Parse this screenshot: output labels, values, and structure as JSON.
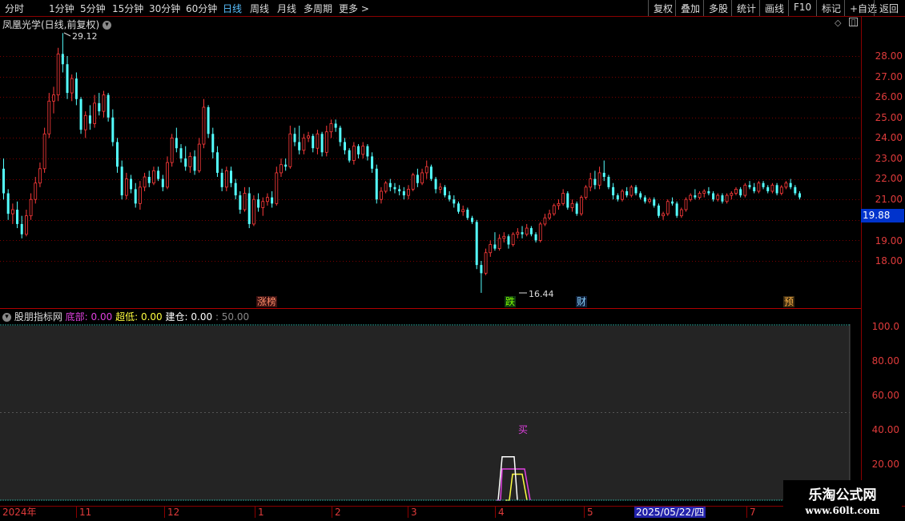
{
  "toolbar": {
    "periods": [
      "分时",
      "1分钟",
      "5分钟",
      "15分钟",
      "30分钟",
      "60分钟",
      "日线",
      "周线",
      "月线",
      "多周期",
      "更多 >"
    ],
    "active_period": "日线",
    "actions": [
      "复权",
      "叠加",
      "多股",
      "统计",
      "画线",
      "F10",
      "标记",
      "+自选",
      "返回"
    ]
  },
  "main": {
    "title": "凤凰光学(日线,前复权)",
    "price_axis": [
      "28.00",
      "27.00",
      "26.00",
      "25.00",
      "24.00",
      "23.00",
      "22.00",
      "21.00",
      "19.00",
      "18.00"
    ],
    "current_price": "19.88",
    "high_marker": "29.12",
    "low_marker": "16.44",
    "events": [
      {
        "label": "涨榜",
        "color": "#ff8c69"
      },
      {
        "label": "跌",
        "color": "#7CFC00"
      },
      {
        "label": "财",
        "color": "#87cefa"
      },
      {
        "label": "预",
        "color": "#ffb347"
      }
    ]
  },
  "indicator": {
    "name": "股朋指标网",
    "items": [
      {
        "label": "底部:",
        "value": "0.00",
        "color": "#e040e0"
      },
      {
        "label": "超低:",
        "value": "0.00",
        "color": "#ffff40"
      },
      {
        "label": "建仓:",
        "value": "0.00",
        "color": "#ffffff"
      }
    ],
    "extra": ": 50.00",
    "axis": [
      "100.0",
      "80.00",
      "60.00",
      "40.00",
      "20.00"
    ],
    "signal_text": "买"
  },
  "dates": [
    "2024年",
    "11",
    "12",
    "1",
    "2",
    "3",
    "4",
    "5",
    "2025/05/22/四",
    "7"
  ],
  "watermark": {
    "line1": "乐淘公式网",
    "line2": "www.60lt.com"
  },
  "colors": {
    "up": "#ff3b3b",
    "down": "#54ffff",
    "grid": "#8b0000",
    "accent": "#59c0ff"
  },
  "chart_data": {
    "type": "candlestick",
    "series": [
      {
        "values": [
          [
            22.5,
            23.0,
            21.0,
            21.3
          ],
          [
            21.3,
            21.5,
            20.0,
            20.3
          ],
          [
            20.3,
            20.8,
            19.8,
            20.5
          ],
          [
            20.5,
            20.9,
            19.6,
            19.8
          ],
          [
            19.8,
            20.2,
            19.1,
            19.3
          ],
          [
            19.3,
            20.5,
            19.2,
            20.2
          ],
          [
            20.2,
            21.3,
            20.0,
            21.0
          ],
          [
            21.0,
            22.1,
            20.8,
            21.8
          ],
          [
            21.8,
            22.8,
            21.6,
            22.5
          ],
          [
            22.5,
            24.5,
            22.3,
            24.2
          ],
          [
            24.2,
            26.2,
            24.0,
            25.8
          ],
          [
            25.8,
            26.5,
            25.2,
            26.1
          ],
          [
            26.1,
            28.4,
            25.8,
            28.1
          ],
          [
            28.1,
            29.12,
            27.2,
            27.6
          ],
          [
            27.6,
            28.0,
            25.9,
            26.2
          ],
          [
            26.2,
            27.1,
            25.8,
            26.9
          ],
          [
            26.9,
            27.2,
            25.6,
            25.9
          ],
          [
            25.9,
            26.0,
            24.2,
            24.4
          ],
          [
            24.4,
            25.3,
            24.0,
            25.1
          ],
          [
            25.1,
            25.6,
            24.4,
            24.7
          ],
          [
            24.7,
            26.1,
            24.5,
            25.7
          ],
          [
            25.7,
            26.2,
            25.1,
            25.3
          ],
          [
            25.3,
            26.3,
            25.0,
            26.1
          ],
          [
            26.1,
            26.2,
            24.8,
            25.0
          ],
          [
            25.0,
            25.4,
            23.6,
            23.8
          ],
          [
            23.8,
            24.0,
            22.3,
            22.6
          ],
          [
            22.6,
            22.9,
            21.0,
            21.2
          ],
          [
            21.2,
            22.3,
            21.0,
            22.0
          ],
          [
            22.0,
            22.2,
            21.3,
            21.5
          ],
          [
            21.5,
            21.8,
            20.6,
            20.8
          ],
          [
            20.8,
            21.9,
            20.5,
            21.6
          ],
          [
            21.6,
            22.3,
            21.4,
            22.1
          ],
          [
            22.1,
            22.4,
            21.6,
            21.8
          ],
          [
            21.8,
            22.6,
            21.7,
            22.4
          ],
          [
            22.4,
            22.6,
            21.9,
            22.0
          ],
          [
            22.0,
            22.2,
            21.4,
            21.6
          ],
          [
            21.6,
            23.1,
            21.5,
            22.8
          ],
          [
            22.8,
            24.2,
            22.6,
            24.0
          ],
          [
            24.0,
            24.5,
            23.3,
            23.5
          ],
          [
            23.5,
            23.7,
            22.8,
            23.0
          ],
          [
            23.0,
            23.6,
            22.4,
            22.6
          ],
          [
            22.6,
            23.3,
            22.3,
            23.1
          ],
          [
            23.1,
            23.4,
            22.2,
            22.4
          ],
          [
            22.4,
            24.0,
            22.3,
            23.7
          ],
          [
            23.7,
            25.9,
            23.5,
            25.5
          ],
          [
            25.5,
            25.6,
            24.0,
            24.2
          ],
          [
            24.2,
            24.5,
            23.0,
            23.3
          ],
          [
            23.3,
            23.6,
            22.1,
            22.3
          ],
          [
            22.3,
            22.5,
            21.4,
            21.6
          ],
          [
            21.6,
            22.6,
            21.4,
            22.4
          ],
          [
            22.4,
            22.6,
            21.6,
            21.8
          ],
          [
            21.8,
            22.0,
            21.0,
            21.2
          ],
          [
            21.2,
            21.4,
            20.3,
            20.5
          ],
          [
            20.5,
            21.6,
            20.4,
            21.3
          ],
          [
            21.3,
            21.6,
            19.6,
            19.8
          ],
          [
            19.8,
            21.2,
            19.7,
            21.0
          ],
          [
            21.0,
            21.3,
            20.4,
            20.6
          ],
          [
            20.6,
            21.1,
            20.2,
            20.9
          ],
          [
            20.9,
            21.3,
            20.7,
            21.1
          ],
          [
            21.1,
            21.4,
            20.6,
            20.8
          ],
          [
            20.8,
            22.6,
            20.7,
            22.3
          ],
          [
            22.3,
            23.0,
            22.1,
            22.7
          ],
          [
            22.7,
            23.0,
            22.4,
            22.6
          ],
          [
            22.6,
            24.6,
            22.5,
            24.2
          ],
          [
            24.2,
            24.5,
            23.6,
            23.8
          ],
          [
            23.8,
            24.6,
            23.2,
            23.4
          ],
          [
            23.4,
            24.2,
            23.2,
            24.0
          ],
          [
            24.0,
            24.3,
            23.8,
            24.1
          ],
          [
            24.1,
            24.2,
            23.3,
            23.5
          ],
          [
            23.5,
            24.4,
            23.2,
            24.2
          ],
          [
            24.2,
            24.3,
            23.1,
            23.3
          ],
          [
            23.3,
            24.6,
            23.1,
            24.3
          ],
          [
            24.3,
            24.9,
            24.0,
            24.7
          ],
          [
            24.7,
            24.9,
            24.3,
            24.5
          ],
          [
            24.5,
            24.6,
            23.6,
            23.8
          ],
          [
            23.8,
            24.0,
            23.2,
            23.4
          ],
          [
            23.4,
            23.5,
            22.8,
            22.9
          ],
          [
            22.9,
            23.8,
            22.7,
            23.6
          ],
          [
            23.6,
            23.7,
            23.0,
            23.2
          ],
          [
            23.2,
            23.8,
            23.0,
            23.6
          ],
          [
            23.6,
            23.7,
            22.9,
            23.1
          ],
          [
            23.1,
            23.3,
            22.3,
            22.5
          ],
          [
            22.5,
            22.7,
            20.8,
            21.0
          ],
          [
            21.0,
            21.6,
            20.8,
            21.4
          ],
          [
            21.4,
            21.9,
            21.3,
            21.8
          ],
          [
            21.8,
            22.0,
            21.4,
            21.6
          ],
          [
            21.6,
            21.8,
            21.3,
            21.5
          ],
          [
            21.5,
            21.7,
            21.2,
            21.4
          ],
          [
            21.4,
            21.6,
            21.0,
            21.2
          ],
          [
            21.2,
            21.7,
            21.0,
            21.5
          ],
          [
            21.5,
            22.3,
            21.4,
            22.2
          ],
          [
            22.2,
            22.5,
            21.6,
            21.8
          ],
          [
            21.8,
            22.5,
            21.7,
            22.3
          ],
          [
            22.3,
            22.9,
            22.0,
            22.6
          ],
          [
            22.6,
            22.7,
            21.9,
            22.0
          ],
          [
            22.0,
            22.1,
            21.3,
            21.5
          ],
          [
            21.5,
            21.8,
            21.3,
            21.6
          ],
          [
            21.6,
            21.7,
            21.1,
            21.2
          ],
          [
            21.2,
            21.4,
            20.9,
            21.0
          ],
          [
            21.0,
            21.2,
            20.6,
            20.8
          ],
          [
            20.8,
            20.9,
            20.3,
            20.4
          ],
          [
            20.4,
            20.7,
            20.2,
            20.5
          ],
          [
            20.5,
            20.6,
            20.0,
            20.1
          ],
          [
            20.1,
            20.2,
            19.8,
            19.9
          ],
          [
            19.9,
            20.0,
            17.6,
            17.8
          ],
          [
            17.8,
            18.0,
            16.44,
            17.4
          ],
          [
            17.4,
            18.6,
            17.3,
            18.4
          ],
          [
            18.4,
            19.0,
            18.2,
            18.8
          ],
          [
            18.8,
            19.4,
            18.5,
            18.6
          ],
          [
            18.6,
            19.3,
            18.5,
            19.1
          ],
          [
            19.1,
            19.4,
            18.9,
            19.2
          ],
          [
            19.2,
            19.3,
            18.6,
            18.8
          ],
          [
            18.8,
            19.4,
            18.7,
            19.3
          ],
          [
            19.3,
            19.6,
            19.1,
            19.4
          ],
          [
            19.4,
            19.7,
            19.1,
            19.3
          ],
          [
            19.3,
            19.8,
            19.2,
            19.6
          ],
          [
            19.6,
            19.7,
            19.2,
            19.3
          ],
          [
            19.3,
            19.4,
            18.9,
            19.0
          ],
          [
            19.0,
            19.9,
            18.9,
            19.8
          ],
          [
            19.8,
            20.3,
            19.7,
            20.1
          ],
          [
            20.1,
            20.5,
            20.0,
            20.3
          ],
          [
            20.3,
            20.8,
            20.2,
            20.7
          ],
          [
            20.7,
            21.0,
            20.5,
            20.8
          ],
          [
            20.8,
            21.5,
            20.7,
            21.3
          ],
          [
            21.3,
            21.4,
            20.5,
            20.6
          ],
          [
            20.6,
            21.0,
            20.4,
            20.8
          ],
          [
            20.8,
            20.9,
            20.2,
            20.3
          ],
          [
            20.3,
            21.2,
            20.2,
            21.1
          ],
          [
            21.1,
            21.7,
            21.0,
            21.6
          ],
          [
            21.6,
            22.3,
            21.4,
            22.0
          ],
          [
            22.0,
            22.4,
            21.5,
            21.7
          ],
          [
            21.7,
            22.6,
            21.5,
            22.3
          ],
          [
            22.3,
            22.9,
            21.9,
            22.1
          ],
          [
            22.1,
            22.2,
            21.5,
            21.6
          ],
          [
            21.6,
            21.8,
            21.0,
            21.2
          ],
          [
            21.2,
            21.3,
            20.9,
            21.0
          ],
          [
            21.0,
            21.5,
            20.9,
            21.4
          ],
          [
            21.4,
            21.6,
            21.1,
            21.2
          ],
          [
            21.2,
            21.7,
            21.1,
            21.6
          ],
          [
            21.6,
            21.7,
            21.2,
            21.3
          ],
          [
            21.3,
            21.4,
            21.0,
            21.1
          ],
          [
            21.1,
            21.2,
            20.8,
            20.9
          ],
          [
            20.9,
            21.1,
            20.8,
            21.0
          ],
          [
            21.0,
            21.1,
            20.6,
            20.7
          ],
          [
            20.7,
            20.8,
            20.1,
            20.2
          ],
          [
            20.2,
            20.4,
            20.0,
            20.3
          ],
          [
            20.3,
            21.0,
            20.2,
            20.9
          ],
          [
            20.9,
            21.1,
            20.7,
            20.8
          ],
          [
            20.8,
            20.9,
            20.1,
            20.2
          ],
          [
            20.2,
            20.6,
            20.1,
            20.5
          ],
          [
            20.5,
            21.1,
            20.4,
            21.0
          ],
          [
            21.0,
            21.3,
            20.9,
            21.2
          ],
          [
            21.2,
            21.5,
            21.0,
            21.1
          ],
          [
            21.1,
            21.4,
            21.0,
            21.3
          ],
          [
            21.3,
            21.5,
            21.1,
            21.4
          ],
          [
            21.4,
            21.6,
            21.2,
            21.3
          ],
          [
            21.3,
            21.4,
            20.9,
            21.0
          ],
          [
            21.0,
            21.3,
            20.9,
            21.2
          ],
          [
            21.2,
            21.3,
            20.8,
            20.9
          ],
          [
            20.9,
            21.3,
            20.8,
            21.2
          ],
          [
            21.2,
            21.4,
            21.0,
            21.3
          ],
          [
            21.3,
            21.6,
            21.2,
            21.5
          ],
          [
            21.5,
            21.6,
            21.1,
            21.2
          ],
          [
            21.2,
            21.8,
            21.1,
            21.7
          ],
          [
            21.7,
            21.9,
            21.5,
            21.6
          ],
          [
            21.6,
            21.8,
            21.3,
            21.4
          ],
          [
            21.4,
            21.9,
            21.3,
            21.8
          ],
          [
            21.8,
            21.9,
            21.5,
            21.6
          ],
          [
            21.6,
            21.7,
            21.3,
            21.4
          ],
          [
            21.4,
            21.8,
            21.3,
            21.7
          ],
          [
            21.7,
            21.8,
            21.2,
            21.3
          ],
          [
            21.3,
            21.7,
            21.2,
            21.6
          ],
          [
            21.6,
            21.9,
            21.5,
            21.8
          ],
          [
            21.8,
            22.0,
            21.5,
            21.6
          ],
          [
            21.6,
            21.7,
            21.2,
            21.3
          ],
          [
            21.3,
            21.4,
            21.0,
            21.1
          ]
        ]
      }
    ],
    "indicator_series": [
      {
        "name": "底部",
        "color": "#e040e0",
        "values": [
          0,
          0,
          18,
          18,
          18,
          0
        ]
      },
      {
        "name": "超低",
        "color": "#ffff40",
        "values": [
          0,
          0,
          15,
          15,
          0
        ]
      },
      {
        "name": "建仓",
        "color": "#ffffff",
        "values": [
          0,
          25,
          25,
          0
        ]
      }
    ],
    "indicator_ylim": [
      0,
      100
    ]
  }
}
